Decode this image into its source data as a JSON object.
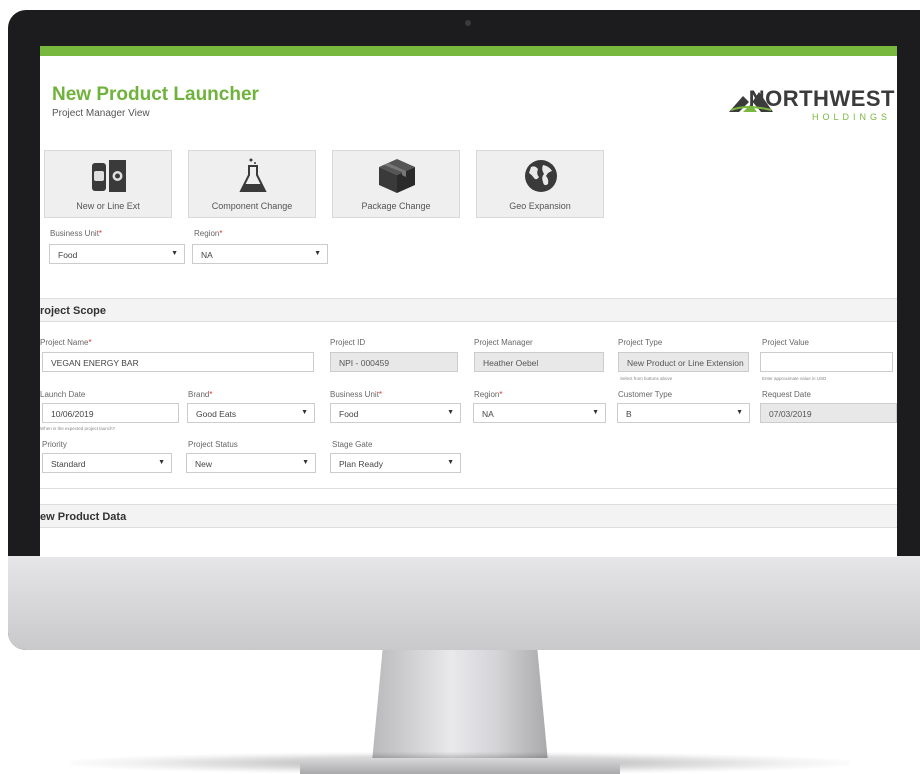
{
  "app": {
    "title": "New Product Launcher",
    "subtitle": "Project Manager View",
    "accent_color": "#79b83e"
  },
  "logo": {
    "name": "NORTHWEST",
    "subtitle": "HOLDINGS"
  },
  "launch_types": [
    {
      "label": "New or Line Ext",
      "icon": "food-products-icon"
    },
    {
      "label": "Component Change",
      "icon": "flask-icon"
    },
    {
      "label": "Package Change",
      "icon": "box-icon"
    },
    {
      "label": "Geo Expansion",
      "icon": "globe-icon"
    }
  ],
  "top_fields": {
    "business_unit": {
      "label": "Business Unit",
      "value": "Food"
    },
    "region": {
      "label": "Region",
      "value": "NA"
    }
  },
  "project_scope": {
    "heading": "roject Scope",
    "project_name": {
      "label": "Project Name",
      "value": "VEGAN ENERGY BAR"
    },
    "project_id": {
      "label": "Project ID",
      "value": "NPI - 000459"
    },
    "project_manager": {
      "label": "Project Manager",
      "value": "Heather Oebel"
    },
    "project_type": {
      "label": "Project Type",
      "value": "New Product or Line Extension",
      "hint": "Select from buttons above"
    },
    "project_value": {
      "label": "Project Value",
      "value": "",
      "hint": "Enter approximate value in USD"
    },
    "launch_date": {
      "label": "Launch Date",
      "value": "10/06/2019",
      "hint": "When is the expected project launch?"
    },
    "brand": {
      "label": "Brand",
      "value": "Good Eats"
    },
    "business_unit": {
      "label": "Business Unit",
      "value": "Food"
    },
    "region": {
      "label": "Region",
      "value": "NA"
    },
    "customer_type": {
      "label": "Customer Type",
      "value": "B"
    },
    "request_date": {
      "label": "Request Date",
      "value": "07/03/2019"
    },
    "priority": {
      "label": "Priority",
      "value": "Standard"
    },
    "project_status": {
      "label": "Project Status",
      "value": "New"
    },
    "stage_gate": {
      "label": "Stage Gate",
      "value": "Plan Ready"
    }
  },
  "new_product_data": {
    "heading": "ew Product Data"
  },
  "required_marker": "*",
  "caret": "▼"
}
